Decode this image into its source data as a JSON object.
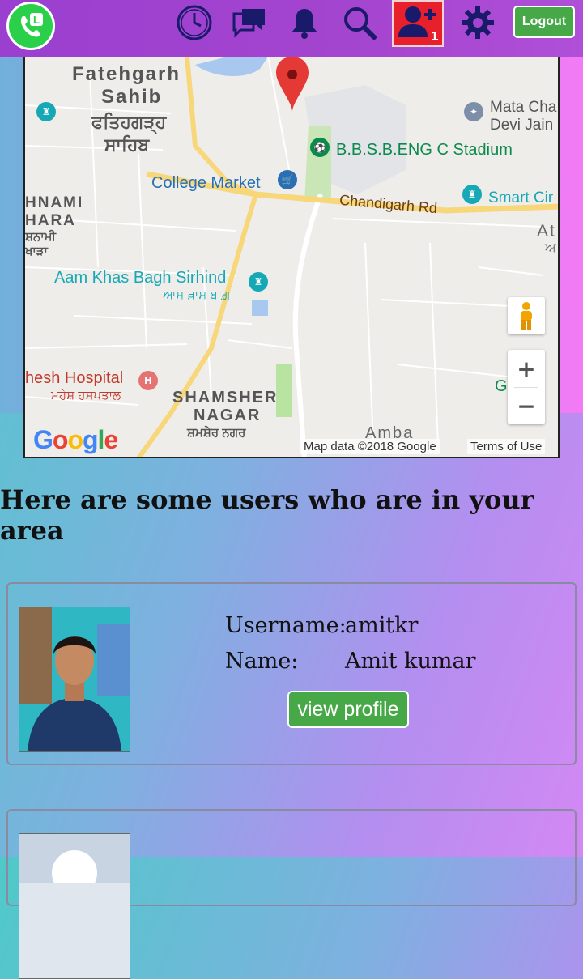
{
  "header": {
    "logout_label": "Logout",
    "friend_requests_count": "1",
    "icons": [
      "clock-icon",
      "chat-icon",
      "bell-icon",
      "search-icon",
      "add-friend-icon",
      "gear-icon"
    ],
    "colors": {
      "bar": "#a445cf",
      "friend_badge": "#e8202c",
      "logout": "#47a847"
    }
  },
  "map": {
    "labels": {
      "fatehgarh": "Fatehgarh",
      "sahib": "Sahib",
      "fatehgarh_pa": "ਫਤਿਹਗੜ੍ਹ",
      "sahib_pa": "ਸਾਹਿਬ",
      "mata_chand": "Mata Cha",
      "devi_jain": "Devi Jain",
      "stadium": "B.B.S.B.ENG C Stadium",
      "college_market": "College Market",
      "chandigarh_rd": "Chandigarh Rd",
      "smart_city": "Smart Cir",
      "shnami": "HNAMI",
      "hara": "HARA",
      "shnami_pa": "ਸ਼ਨਾਮੀ",
      "khara_pa": "ਖਾੜਾ",
      "at": "At",
      "at_pa": "ਅ",
      "aam_khas": "Aam Khas Bagh Sirhind",
      "aam_khas_pa": "ਆਮ ਖ਼ਾਸ ਬਾਗ਼",
      "hospital": "hesh Hospital",
      "hospital_pa": "ਮਹੇਸ਼ ਹਸਪਤਾਲ",
      "shamsher": "SHAMSHER",
      "nagar": "NAGAR",
      "shamsher_pa": "ਸ਼ਮਸ਼ੇਰ ਨਗਰ",
      "amba": "Amba",
      "g_label": "G"
    },
    "google": "Google",
    "attribution": "Map data ©2018 Google",
    "terms": "Terms of Use",
    "zoom_in": "+",
    "zoom_out": "−"
  },
  "main": {
    "heading": "Here are some users who are in your area",
    "users": [
      {
        "username_label": "Username:",
        "username": "amitkr",
        "name_label": "Name:",
        "name": "Amit kumar",
        "button": "view profile"
      }
    ]
  }
}
